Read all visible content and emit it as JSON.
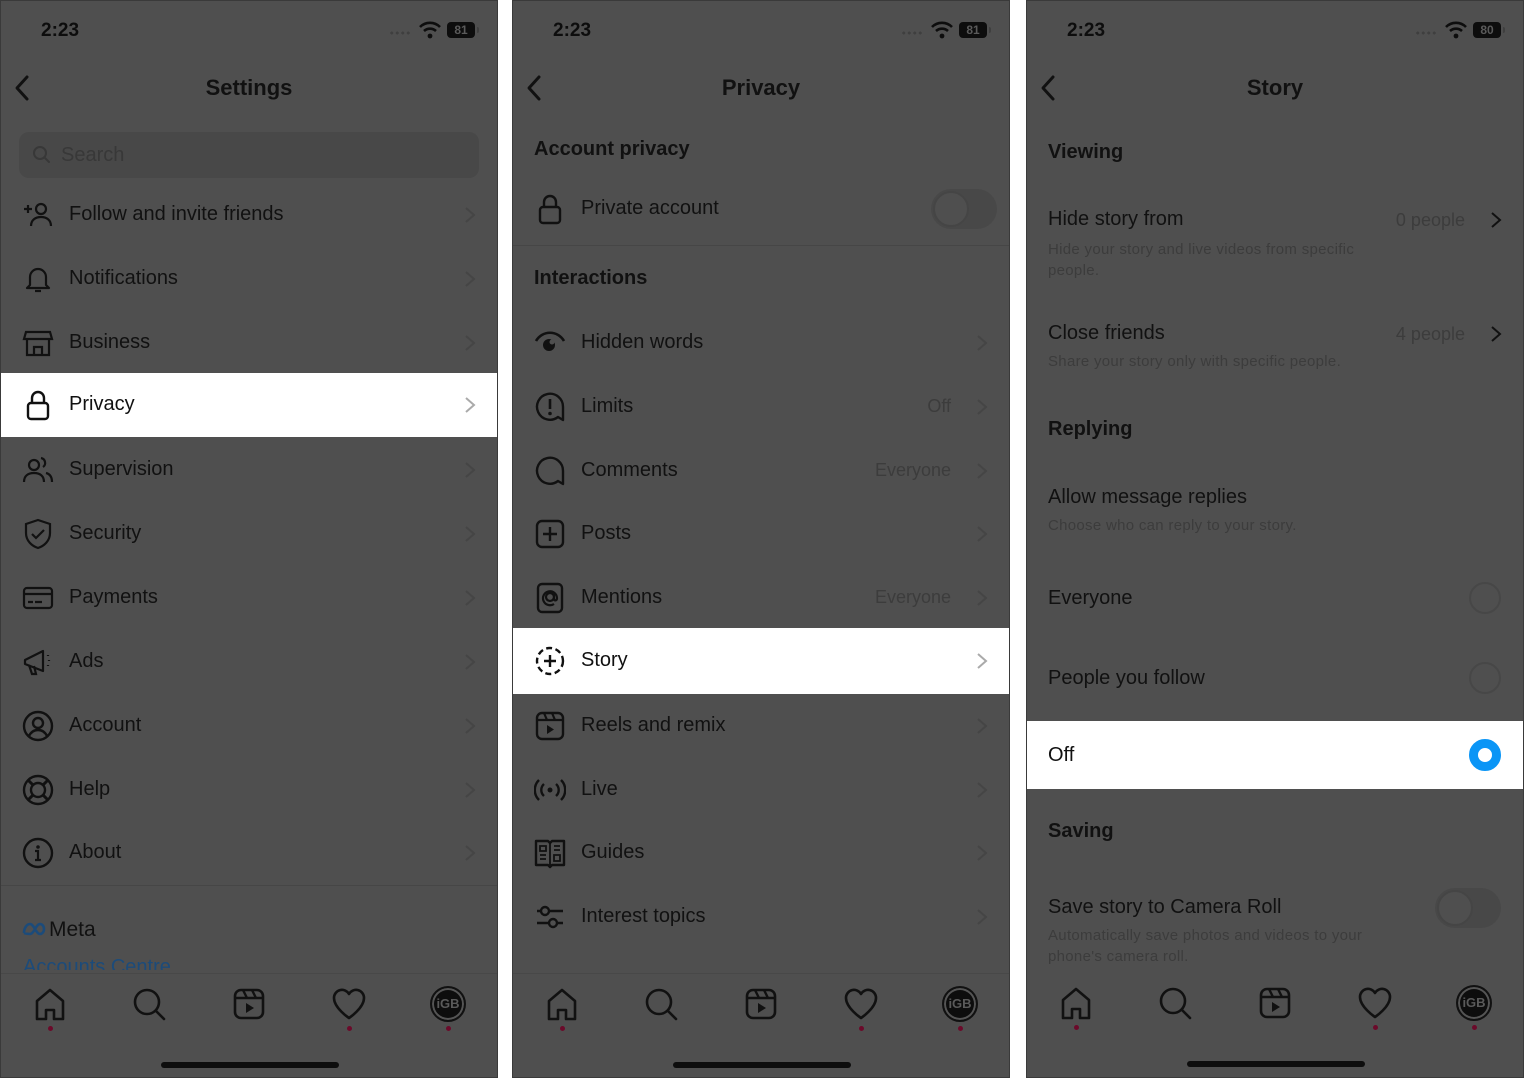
{
  "panels": [
    {
      "status": {
        "time": "2:23",
        "battery": "81"
      },
      "title": "Settings",
      "search": {
        "placeholder": "Search",
        "value": ""
      },
      "items": [
        {
          "label": "Follow and invite friends",
          "icon": "add-person-icon"
        },
        {
          "label": "Notifications",
          "icon": "bell-icon"
        },
        {
          "label": "Business",
          "icon": "shop-icon"
        },
        {
          "label": "Privacy",
          "icon": "lock-icon",
          "highlighted": true
        },
        {
          "label": "Supervision",
          "icon": "people-icon"
        },
        {
          "label": "Security",
          "icon": "shield-check-icon"
        },
        {
          "label": "Payments",
          "icon": "credit-card-icon"
        },
        {
          "label": "Ads",
          "icon": "megaphone-icon"
        },
        {
          "label": "Account",
          "icon": "user-circle-icon"
        },
        {
          "label": "Help",
          "icon": "lifebuoy-icon"
        },
        {
          "label": "About",
          "icon": "info-icon"
        }
      ],
      "meta": {
        "brand": "Meta",
        "link": "Accounts Centre"
      }
    },
    {
      "status": {
        "time": "2:23",
        "battery": "81"
      },
      "title": "Privacy",
      "sections": {
        "account_privacy": "Account privacy",
        "interactions": "Interactions"
      },
      "private_account": {
        "label": "Private account",
        "enabled": false
      },
      "items": [
        {
          "label": "Hidden words",
          "value": "",
          "icon": "eye-icon"
        },
        {
          "label": "Limits",
          "value": "Off",
          "icon": "alert-bubble-icon"
        },
        {
          "label": "Comments",
          "value": "Everyone",
          "icon": "comment-icon"
        },
        {
          "label": "Posts",
          "value": "",
          "icon": "plus-square-icon"
        },
        {
          "label": "Mentions",
          "value": "Everyone",
          "icon": "at-icon"
        },
        {
          "label": "Story",
          "value": "",
          "icon": "story-add-icon",
          "highlighted": true
        },
        {
          "label": "Reels and remix",
          "value": "",
          "icon": "reels-icon"
        },
        {
          "label": "Live",
          "value": "",
          "icon": "live-icon"
        },
        {
          "label": "Guides",
          "value": "",
          "icon": "guide-icon"
        },
        {
          "label": "Interest topics",
          "value": "",
          "icon": "sliders-icon"
        }
      ]
    },
    {
      "status": {
        "time": "2:23",
        "battery": "80"
      },
      "title": "Story",
      "viewing": {
        "heading": "Viewing",
        "hide_story": {
          "title": "Hide story from",
          "value": "0 people",
          "desc": "Hide your story and live videos from specific people."
        },
        "close_friends": {
          "title": "Close friends",
          "value": "4 people",
          "desc": "Share your story only with specific people."
        }
      },
      "replying": {
        "heading": "Replying",
        "title": "Allow message replies",
        "desc": "Choose who can reply to your story.",
        "options": [
          {
            "label": "Everyone",
            "selected": false
          },
          {
            "label": "People you follow",
            "selected": false
          },
          {
            "label": "Off",
            "selected": true
          }
        ]
      },
      "saving": {
        "heading": "Saving",
        "title": "Save story to Camera Roll",
        "desc": "Automatically save photos and videos to your phone's camera roll.",
        "enabled": false
      }
    }
  ],
  "tabbar": {
    "tabs": [
      "home-icon",
      "search-icon",
      "reels-icon",
      "heart-icon",
      "profile-avatar"
    ],
    "avatar_text": "iGB",
    "dots": [
      true,
      false,
      false,
      true,
      true
    ]
  },
  "colors": {
    "overlay_bg": "#4f4f4f",
    "highlight": "#ffffff",
    "radio_selected": "#0a95f6",
    "notification_dot": "#6b0a2a"
  }
}
